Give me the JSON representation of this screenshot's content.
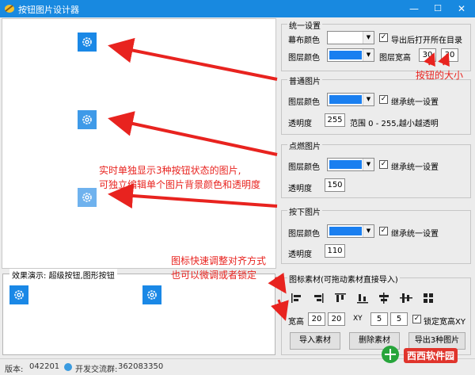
{
  "window": {
    "title": "按钮图片设计器",
    "minimize": "—",
    "maximize": "☐",
    "close": "✕"
  },
  "canvas_icons": [
    "gear-icon",
    "gear-icon",
    "gear-icon"
  ],
  "demo": {
    "title": "效果演示: 超级按钮,图形按钮"
  },
  "status": {
    "version_label": "版本:",
    "version": "042201",
    "group_label": "开发交流群:",
    "group": "362083350"
  },
  "uniform": {
    "title": "统一设置",
    "curtain_color_label": "幕布颜色",
    "layer_color_label": "图层颜色",
    "open_dir_label": "导出后打开所在目录",
    "open_dir_checked": true,
    "size_label": "图层宽高",
    "width": "30",
    "height": "30",
    "curtain_color": "#ffffff",
    "layer_color": "#1a7ff0"
  },
  "normal": {
    "title": "普通图片",
    "layer_color_label": "图层颜色",
    "inherit_label": "继承统一设置",
    "inherit_checked": true,
    "alpha_label": "透明度",
    "alpha": "255",
    "range_hint": "范围 0 - 255,越小越透明",
    "color": "#1a7ff0"
  },
  "hover": {
    "title": "点燃图片",
    "layer_color_label": "图层颜色",
    "inherit_label": "继承统一设置",
    "inherit_checked": true,
    "alpha_label": "透明度",
    "alpha": "150",
    "color": "#1a7ff0"
  },
  "pressed": {
    "title": "按下图片",
    "layer_color_label": "图层颜色",
    "inherit_label": "继承统一设置",
    "inherit_checked": true,
    "alpha_label": "透明度",
    "alpha": "110",
    "color": "#1a7ff0"
  },
  "material": {
    "title": "图标素材(可拖动素材直接导入)",
    "align_icons": [
      "align-left-icon",
      "align-right-icon",
      "align-top-icon",
      "align-bottom-icon",
      "align-center-h-icon",
      "align-center-v-icon",
      "grid-icon"
    ],
    "size_label": "宽高",
    "w": "20",
    "h": "20",
    "xy_label": "XY",
    "x": "5",
    "y": "5",
    "lock_label": "锁定宽高XY",
    "lock_checked": true,
    "import_button": "导入素材",
    "delete_button": "删除素材",
    "export_button": "导出3种图片"
  },
  "annotations": {
    "size_note": "按钮的大小",
    "realtime_note_1": "实时单独显示3种按钮状态的图片,",
    "realtime_note_2": "可独立编辑单个图片背景颜色和透明度",
    "align_note_1": "图标快速调整对齐方式",
    "align_note_2": "也可以微调或者锁定"
  },
  "watermark": {
    "text": "西西软件园"
  },
  "colors": {
    "titlebar": "#1889e0",
    "accent": "#1a88e6",
    "annotation": "#e8231f"
  }
}
